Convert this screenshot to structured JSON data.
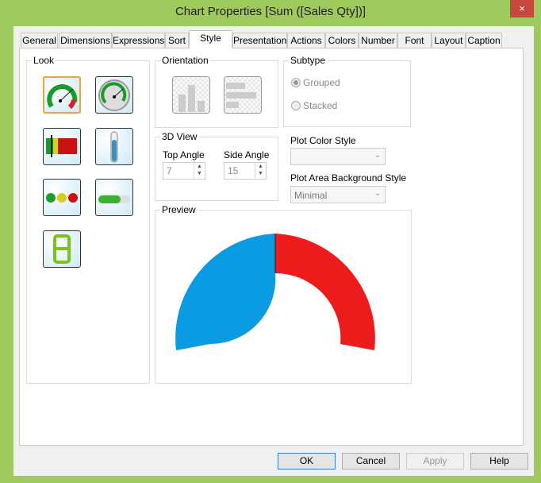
{
  "window": {
    "title": "Chart Properties [Sum ([Sales Qty])]",
    "close": "×"
  },
  "tabs": [
    "General",
    "Dimensions",
    "Expressions",
    "Sort",
    "Style",
    "Presentation",
    "Actions",
    "Colors",
    "Number",
    "Font",
    "Layout",
    "Caption"
  ],
  "active_tab": "Style",
  "look": {
    "label": "Look",
    "items": [
      "gauge-circular",
      "gauge-circular-silver",
      "linear-gauge",
      "thermometer",
      "traffic-light",
      "progress-bar",
      "led-digit"
    ],
    "selected": "gauge-circular"
  },
  "orientation": {
    "label": "Orientation",
    "options": [
      "vertical",
      "horizontal"
    ]
  },
  "subtype": {
    "label": "Subtype",
    "options": [
      "Grouped",
      "Stacked"
    ],
    "selected": "Grouped"
  },
  "view3d": {
    "label": "3D View",
    "top_angle_label": "Top Angle",
    "top_angle": "7",
    "side_angle_label": "Side Angle",
    "side_angle": "15"
  },
  "plot_color_style": {
    "label": "Plot Color Style",
    "value": ""
  },
  "plot_area_bg": {
    "label": "Plot Area Background Style",
    "value": "Minimal"
  },
  "preview": {
    "label": "Preview",
    "colors": {
      "left": "#0a9be2",
      "right": "#ed1c1c"
    }
  },
  "buttons": {
    "ok": "OK",
    "cancel": "Cancel",
    "apply": "Apply",
    "help": "Help"
  }
}
